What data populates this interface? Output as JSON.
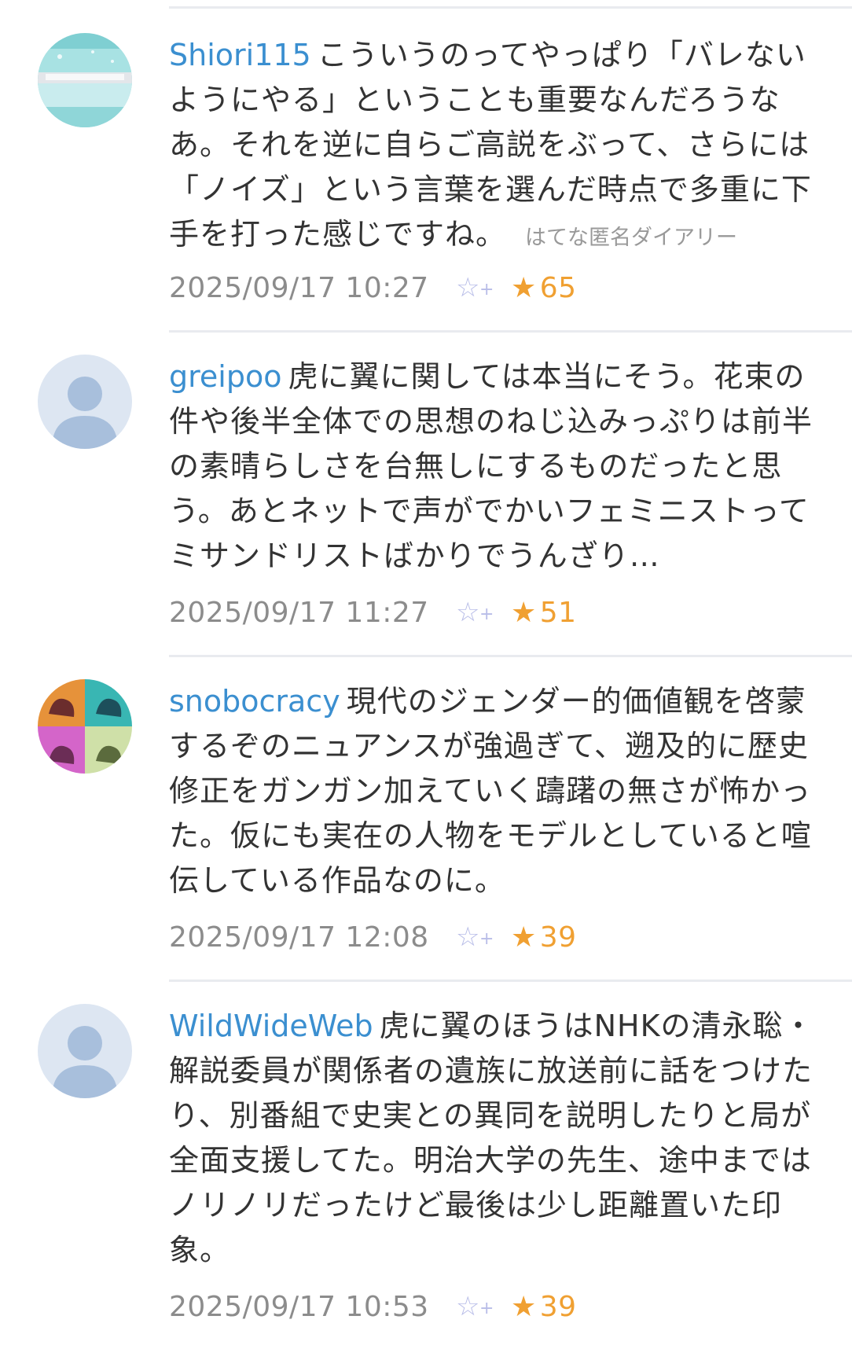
{
  "comments": [
    {
      "user": "Shiori115",
      "text": "こういうのってやっぱり「バレないようにやる」ということも重要なんだろうなあ。それを逆に自らご高説をぶって、さらには「ノイズ」という言葉を選んだ時点で多重に下手を打った感じですね。",
      "source": "はてな匿名ダイアリー",
      "timestamp": "2025/09/17 10:27",
      "add_star_glyph": "☆",
      "add_star_plus": "+",
      "star_glyph": "★",
      "stars": "65",
      "avatar_colors": [
        "#8fd6d8",
        "#c9ecee",
        "#e3e6ea"
      ]
    },
    {
      "user": "greipoo",
      "text": "虎に翼に関しては本当にそう。花束の件や後半全体での思想のねじ込みっぷりは前半の素晴らしさを台無しにするものだったと思う。あとネットで声がでかいフェミニストってミサンドリストばかりでうんざり…",
      "timestamp": "2025/09/17 11:27",
      "add_star_glyph": "☆",
      "add_star_plus": "+",
      "star_glyph": "★",
      "stars": "51",
      "avatar_colors": [
        "#dde6f2",
        "#a8bfdc"
      ]
    },
    {
      "user": "snobocracy",
      "text": "現代のジェンダー的価値観を啓蒙するぞのニュアンスが強過ぎて、遡及的に歴史修正をガンガン加えていく躊躇の無さが怖かった。仮にも実在の人物をモデルとしていると喧伝している作品なのに。",
      "timestamp": "2025/09/17 12:08",
      "add_star_glyph": "☆",
      "add_star_plus": "+",
      "star_glyph": "★",
      "stars": "39",
      "avatar_colors": [
        "#e6923a",
        "#39b6b3",
        "#d465c9",
        "#cfe0a8"
      ]
    },
    {
      "user": "WildWideWeb",
      "text": "虎に翼のほうはNHKの清永聡・解説委員が関係者の遺族に放送前に話をつけたり、別番組で史実との異同を説明したりと局が全面支援してた。明治大学の先生、途中まではノリノリだったけど最後は少し距離置いた印象。",
      "timestamp": "2025/09/17 10:53",
      "add_star_glyph": "☆",
      "add_star_plus": "+",
      "star_glyph": "★",
      "stars": "39",
      "avatar_colors": [
        "#dde6f2",
        "#a8bfdc"
      ]
    }
  ]
}
